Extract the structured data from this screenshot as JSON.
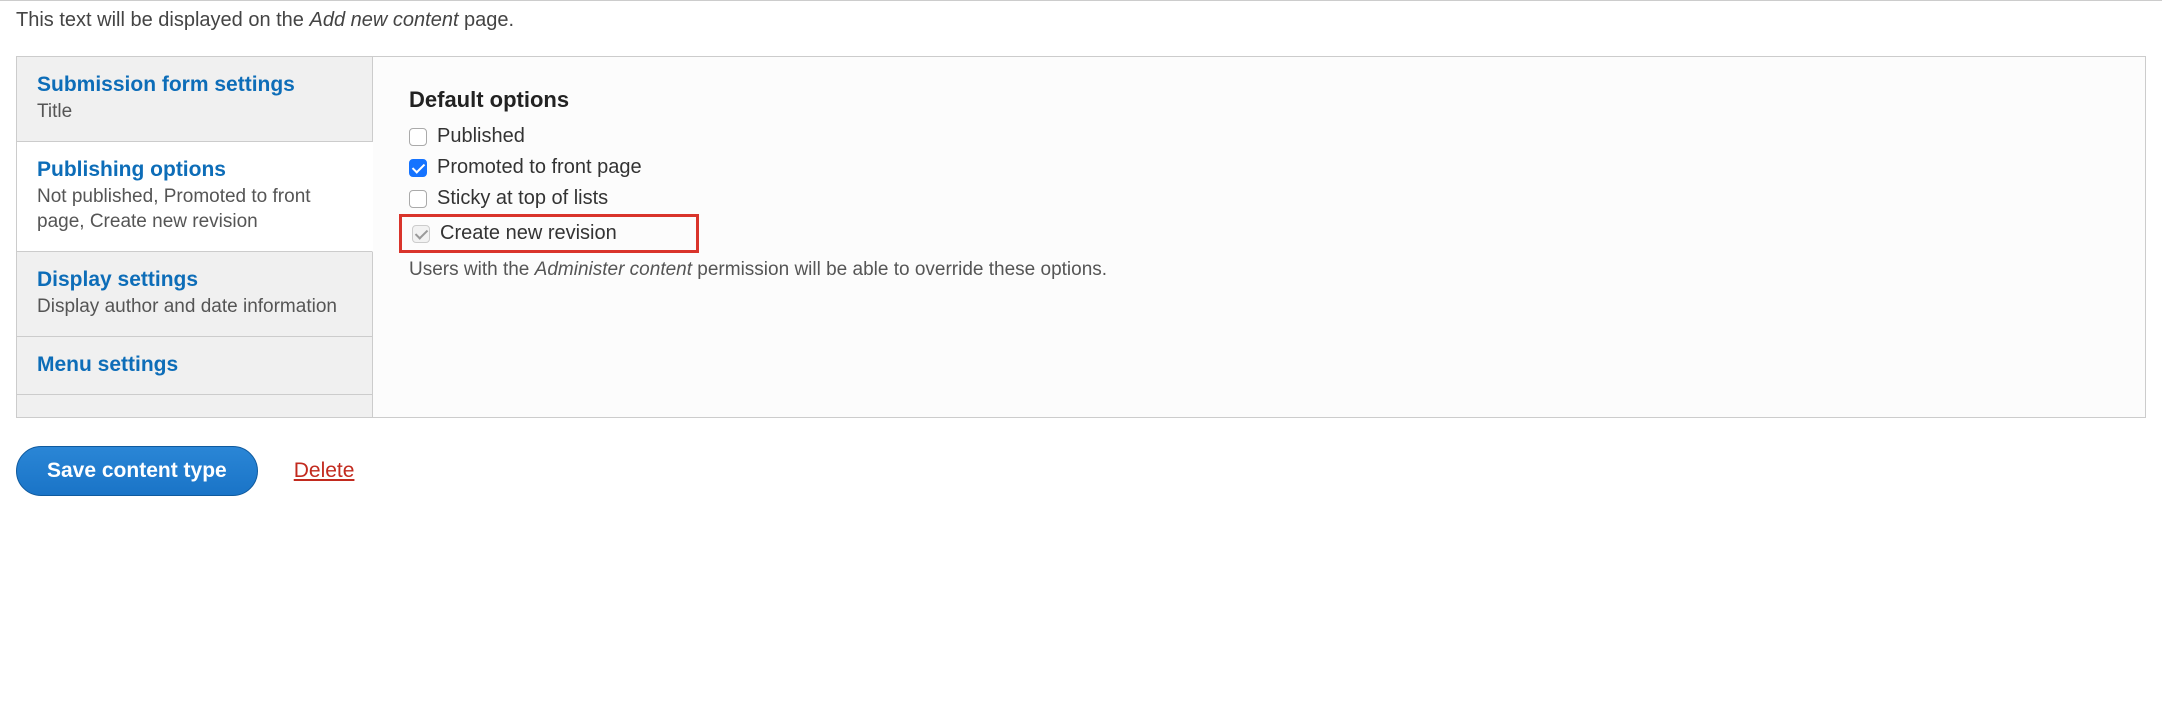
{
  "help": {
    "prefix": "This text will be displayed on the ",
    "italic": "Add new content",
    "suffix": " page."
  },
  "tabs": {
    "submission": {
      "title": "Submission form settings",
      "summary": "Title"
    },
    "publishing": {
      "title": "Publishing options",
      "summary": "Not published, Promoted to front page, Create new revision"
    },
    "display": {
      "title": "Display settings",
      "summary": "Display author and date information"
    },
    "menu": {
      "title": "Menu settings",
      "summary": ""
    }
  },
  "panel": {
    "heading": "Default options",
    "options": {
      "published": {
        "label": "Published",
        "checked": false,
        "disabled": false
      },
      "promoted": {
        "label": "Promoted to front page",
        "checked": true,
        "disabled": false
      },
      "sticky": {
        "label": "Sticky at top of lists",
        "checked": false,
        "disabled": false
      },
      "revision": {
        "label": "Create new revision",
        "checked": true,
        "disabled": true
      }
    },
    "helpPrefix": "Users with the ",
    "helpItalic": "Administer content",
    "helpSuffix": " permission will be able to override these options."
  },
  "actions": {
    "save": "Save content type",
    "delete": "Delete"
  },
  "colors": {
    "accent": "#1573ff",
    "link": "#0d6db8",
    "danger": "#c22a1e",
    "highlight": "#d9342b"
  }
}
